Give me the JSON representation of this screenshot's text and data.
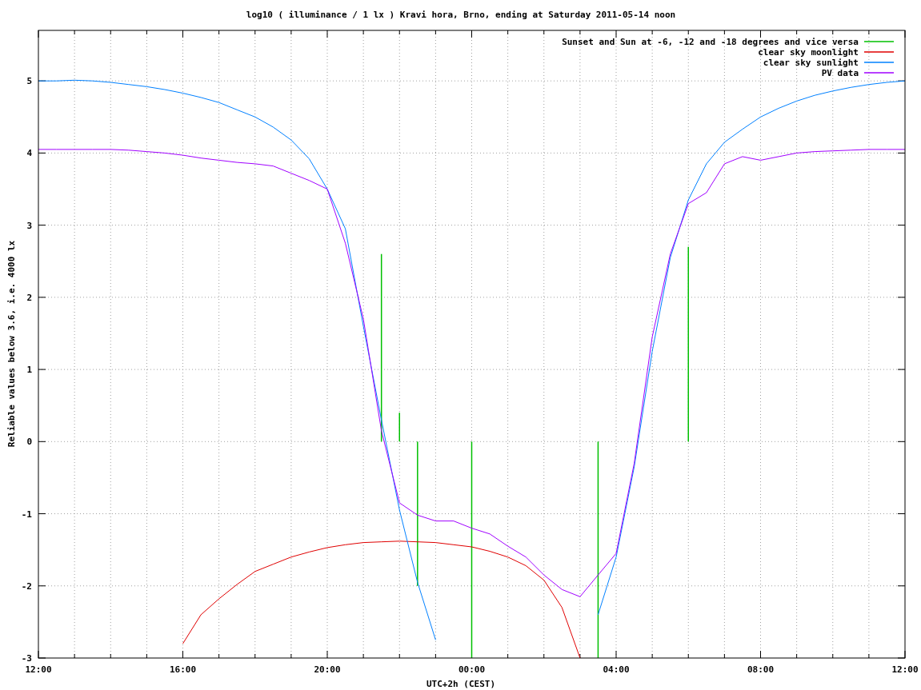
{
  "chart_data": {
    "type": "line",
    "title": "log10 ( illuminance / 1 lx ) Kravi hora, Brno, ending at Saturday 2011-05-14 noon",
    "xlabel": "UTC+2h (CEST)",
    "ylabel": "Reliable values below 3.6, i.e. 4000 lx",
    "ylim": [
      -3,
      5.7
    ],
    "categories": [
      "12:00",
      null,
      null,
      null,
      null,
      null,
      null,
      null,
      "16:00",
      null,
      null,
      null,
      null,
      null,
      null,
      null,
      "20:00",
      null,
      null,
      null,
      null,
      null,
      null,
      null,
      "00:00",
      null,
      null,
      null,
      null,
      null,
      null,
      null,
      "04:00",
      null,
      null,
      null,
      null,
      null,
      null,
      null,
      "08:00",
      null,
      null,
      null,
      null,
      null,
      null,
      null,
      "12:00"
    ],
    "yticks": [
      -3,
      -2,
      -1,
      0,
      1,
      2,
      3,
      4,
      5
    ],
    "grid": true,
    "legend": "upper right",
    "series": [
      {
        "name": "Sunset and Sun at -6, -12 and -18 degrees and vice versa",
        "color": "#00c000",
        "type": "bar",
        "values": [
          null,
          null,
          null,
          null,
          null,
          null,
          null,
          null,
          null,
          null,
          null,
          null,
          null,
          null,
          null,
          null,
          null,
          null,
          null,
          2.6,
          0.4,
          -2,
          null,
          null,
          -3,
          null,
          null,
          null,
          null,
          null,
          null,
          -3,
          null,
          null,
          null,
          null,
          2.7,
          null,
          null,
          null,
          null,
          null,
          null,
          null,
          null,
          null,
          null,
          null,
          null
        ]
      },
      {
        "name": "clear sky moonlight",
        "color": "#e00000",
        "values": [
          null,
          null,
          null,
          null,
          null,
          null,
          null,
          null,
          -2.8,
          -2.4,
          -2.18,
          -1.98,
          -1.8,
          -1.7,
          -1.6,
          -1.53,
          -1.47,
          -1.43,
          -1.4,
          -1.39,
          -1.38,
          -1.39,
          -1.4,
          -1.43,
          -1.46,
          -1.52,
          -1.6,
          -1.72,
          -1.92,
          -2.3,
          -3,
          null,
          null,
          null,
          null,
          null,
          null,
          null,
          null,
          null,
          null,
          null,
          null,
          null,
          null,
          null,
          null,
          null,
          null
        ]
      },
      {
        "name": "clear sky sunlight",
        "color": "#0080ff",
        "values": [
          5,
          5,
          5.01,
          5,
          4.98,
          4.95,
          4.92,
          4.88,
          4.83,
          4.77,
          4.7,
          4.6,
          4.5,
          4.36,
          4.18,
          3.92,
          3.5,
          2.95,
          1.6,
          0.3,
          -0.95,
          -1.95,
          -2.75,
          null,
          null,
          null,
          null,
          null,
          null,
          null,
          null,
          -2.4,
          -1.6,
          -0.35,
          1.25,
          2.55,
          3.35,
          3.85,
          4.15,
          4.33,
          4.5,
          4.62,
          4.72,
          4.8,
          4.86,
          4.91,
          4.95,
          4.98,
          5
        ]
      },
      {
        "name": "PV data",
        "color": "#a000ff",
        "values": [
          4.05,
          4.05,
          4.05,
          4.05,
          4.05,
          4.04,
          4.02,
          4,
          3.97,
          3.93,
          3.9,
          3.87,
          3.85,
          3.82,
          3.72,
          3.62,
          3.5,
          2.75,
          1.7,
          0.15,
          -0.85,
          -1.02,
          -1.1,
          -1.1,
          -1.2,
          -1.28,
          -1.45,
          -1.6,
          -1.85,
          -2.05,
          -2.15,
          -1.85,
          -1.55,
          -0.3,
          1.45,
          2.6,
          3.3,
          3.45,
          3.85,
          3.95,
          3.9,
          3.95,
          4,
          4.02,
          4.03,
          4.04,
          4.05,
          4.05,
          4.05
        ]
      }
    ]
  }
}
